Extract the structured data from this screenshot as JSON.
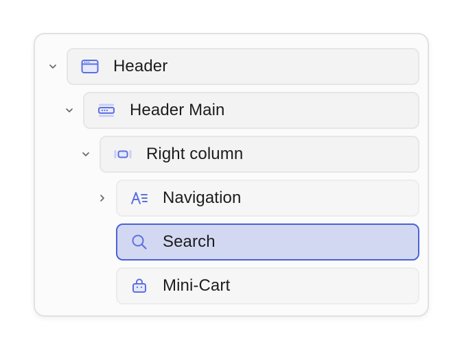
{
  "tree": {
    "items": [
      {
        "label": "Header",
        "icon": "window-icon",
        "expander": "expanded"
      },
      {
        "label": "Header Main",
        "icon": "header-bar-icon",
        "expander": "expanded"
      },
      {
        "label": "Right column",
        "icon": "column-icon",
        "expander": "expanded"
      },
      {
        "label": "Navigation",
        "icon": "navigation-icon",
        "expander": "collapsed"
      },
      {
        "label": "Search",
        "icon": "search-icon",
        "expander": "none",
        "selected": true
      },
      {
        "label": "Mini-Cart",
        "icon": "bag-icon",
        "expander": "none"
      }
    ]
  },
  "colors": {
    "accent": "#4a61d6",
    "selected_background": "#d3d8f2",
    "icon": "#5b6fe0"
  }
}
